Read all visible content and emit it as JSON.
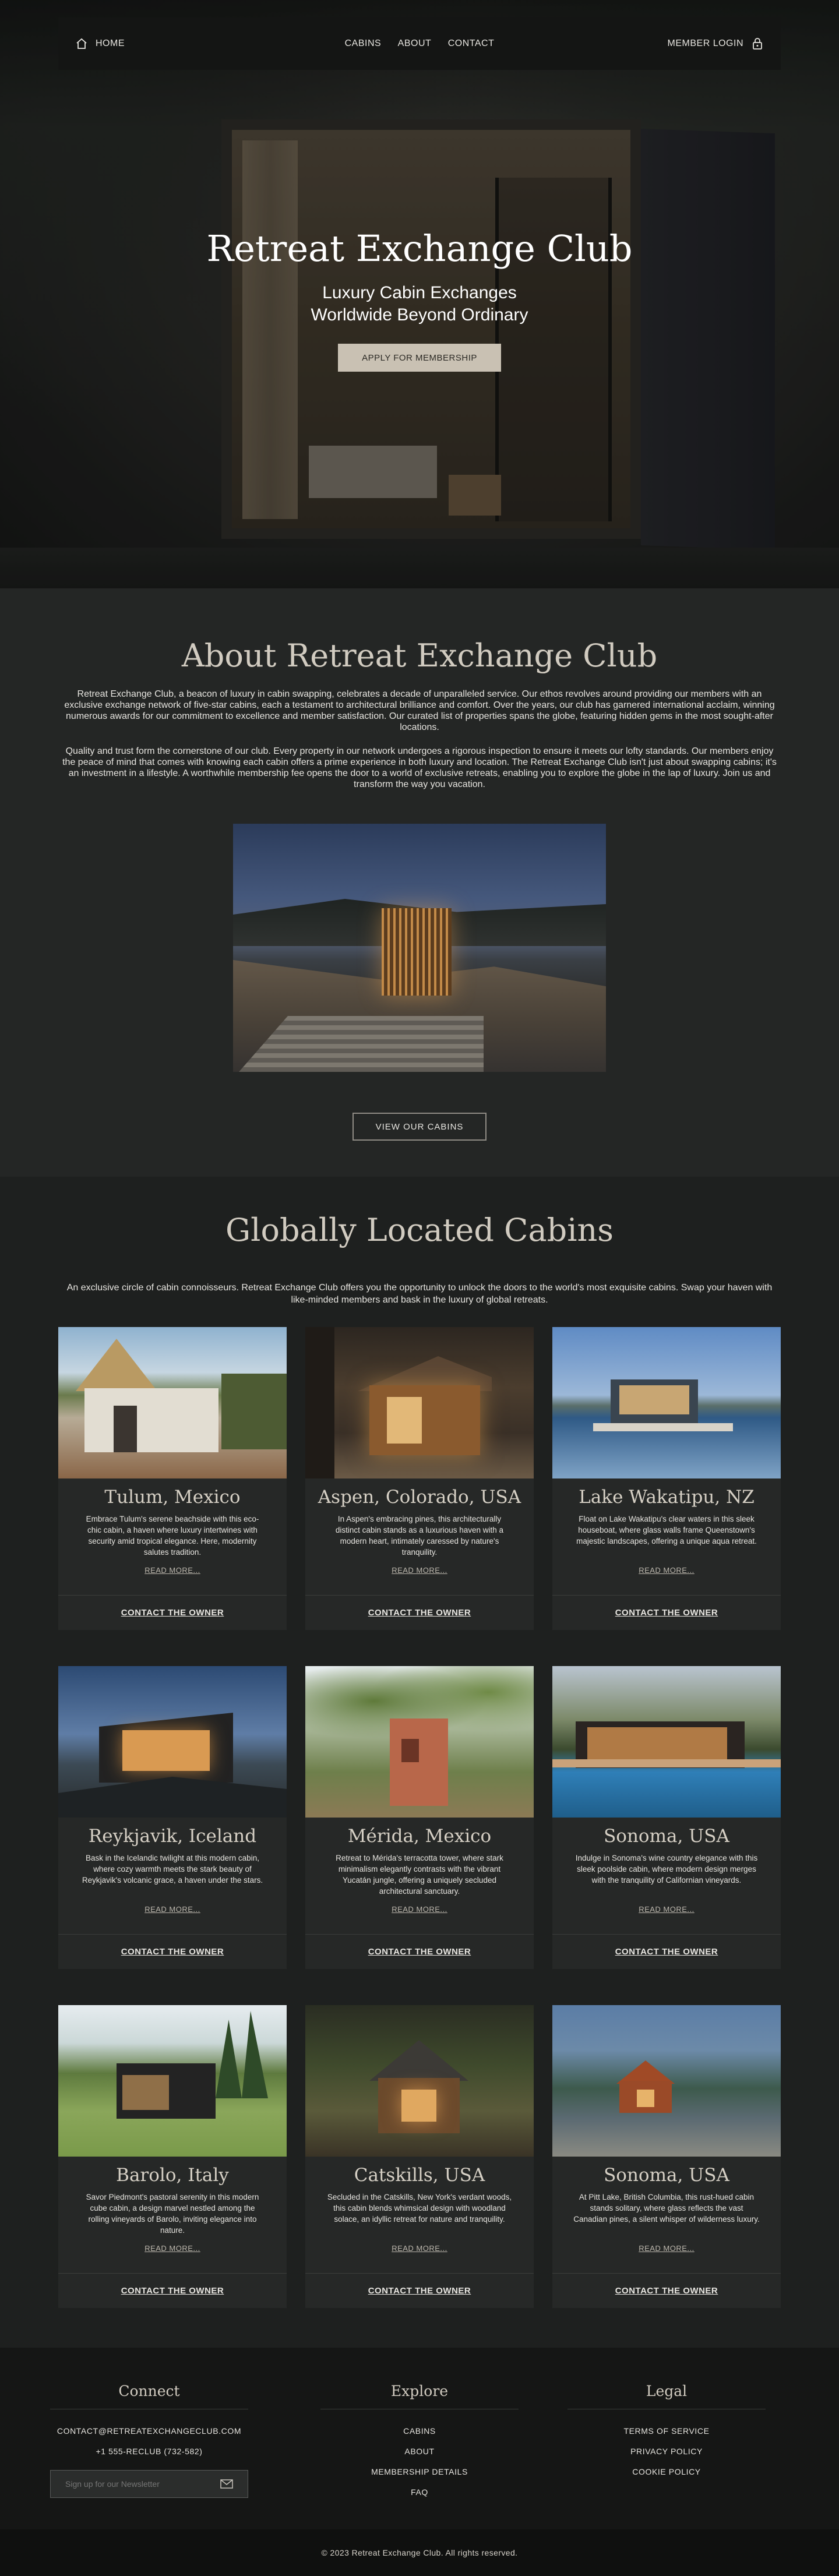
{
  "nav": {
    "home_label": "HOME",
    "links": [
      "CABINS",
      "ABOUT",
      "CONTACT"
    ],
    "login_label": "MEMBER LOGIN"
  },
  "hero": {
    "title": "Retreat Exchange Club",
    "subtitle": "Luxury Cabin Exchanges Worldwide Beyond Ordinary",
    "cta": "APPLY FOR MEMBERSHIP"
  },
  "about": {
    "title": "About Retreat Exchange Club",
    "paragraph1": "Retreat Exchange Club, a beacon of luxury in cabin swapping, celebrates a decade of unparalleled service. Our ethos revolves around providing our members with an exclusive exchange network of five-star cabins, each a testament to architectural brilliance and comfort. Over the years, our club has garnered international acclaim, winning numerous awards for our commitment to excellence and member satisfaction. Our curated list of properties spans the globe, featuring hidden gems in the most sought-after locations.",
    "paragraph2": "Quality and trust form the cornerstone of our club. Every property in our network undergoes a rigorous inspection to ensure it meets our lofty standards. Our members enjoy the peace of mind that comes with knowing each cabin offers a prime experience in both luxury and location. The Retreat Exchange Club isn't just about swapping cabins; it's an investment in a lifestyle. A worthwhile membership fee opens the door to a world of exclusive retreats, enabling you to explore the globe in the lap of luxury. Join us and transform the way you vacation.",
    "button": "VIEW OUR CABINS"
  },
  "cabins": {
    "title": "Globally Located Cabins",
    "intro": "An exclusive circle of cabin connoisseurs. Retreat Exchange Club offers you the opportunity to unlock the doors to the world's most exquisite cabins. Swap your haven with like-minded members and bask in the luxury of global retreats.",
    "read_more": "READ MORE...",
    "contact": "CONTACT THE OWNER",
    "items": [
      {
        "name": "Tulum, Mexico",
        "desc": "Embrace Tulum's serene beachside with this eco-chic cabin, a haven where luxury intertwines with security amid tropical elegance. Here, modernity salutes tradition."
      },
      {
        "name": "Aspen, Colorado, USA",
        "desc": "In Aspen's embracing pines, this architecturally distinct cabin stands as a luxurious haven with a modern heart, intimately caressed by nature's tranquility."
      },
      {
        "name": "Lake Wakatipu, NZ",
        "desc": "Float on Lake Wakatipu's clear waters in this sleek houseboat, where glass walls frame Queenstown's majestic landscapes, offering a unique aqua retreat."
      },
      {
        "name": "Reykjavik, Iceland",
        "desc": "Bask in the Icelandic twilight at this modern cabin, where cozy warmth meets the stark beauty of Reykjavik's volcanic grace, a haven under the stars."
      },
      {
        "name": "Mérida, Mexico",
        "desc": "Retreat to Mérida's terracotta tower, where stark minimalism elegantly contrasts with the vibrant Yucatán jungle, offering a uniquely secluded architectural sanctuary."
      },
      {
        "name": "Sonoma, USA",
        "desc": "Indulge in Sonoma's wine country elegance with this sleek poolside cabin, where modern design merges with the tranquility of Californian vineyards."
      },
      {
        "name": "Barolo, Italy",
        "desc": "Savor Piedmont's pastoral serenity in this modern cube cabin, a design marvel nestled among the rolling vineyards of Barolo, inviting elegance into nature."
      },
      {
        "name": "Catskills, USA",
        "desc": "Secluded in the Catskills, New York's verdant woods, this cabin blends whimsical design with woodland solace, an idyllic retreat for nature and tranquility."
      },
      {
        "name": "Sonoma, USA",
        "desc": "At Pitt Lake, British Columbia, this rust-hued cabin stands solitary, where glass reflects the vast Canadian pines, a silent whisper of wilderness luxury."
      }
    ]
  },
  "footer": {
    "connect_title": "Connect",
    "email": "CONTACT@RETREATEXCHANGECLUB.COM",
    "phone": "+1 555-RECLUB (732-582)",
    "newsletter_placeholder": "Sign up for our Newsletter",
    "explore_title": "Explore",
    "explore_links": [
      "CABINS",
      "ABOUT",
      "MEMBERSHIP DETAILS",
      "FAQ"
    ],
    "legal_title": "Legal",
    "legal_links": [
      "TERMS OF SERVICE",
      "PRIVACY POLICY",
      "COOKIE POLICY"
    ],
    "copyright": "© 2023 Retreat Exchange Club. All rights reserved."
  }
}
